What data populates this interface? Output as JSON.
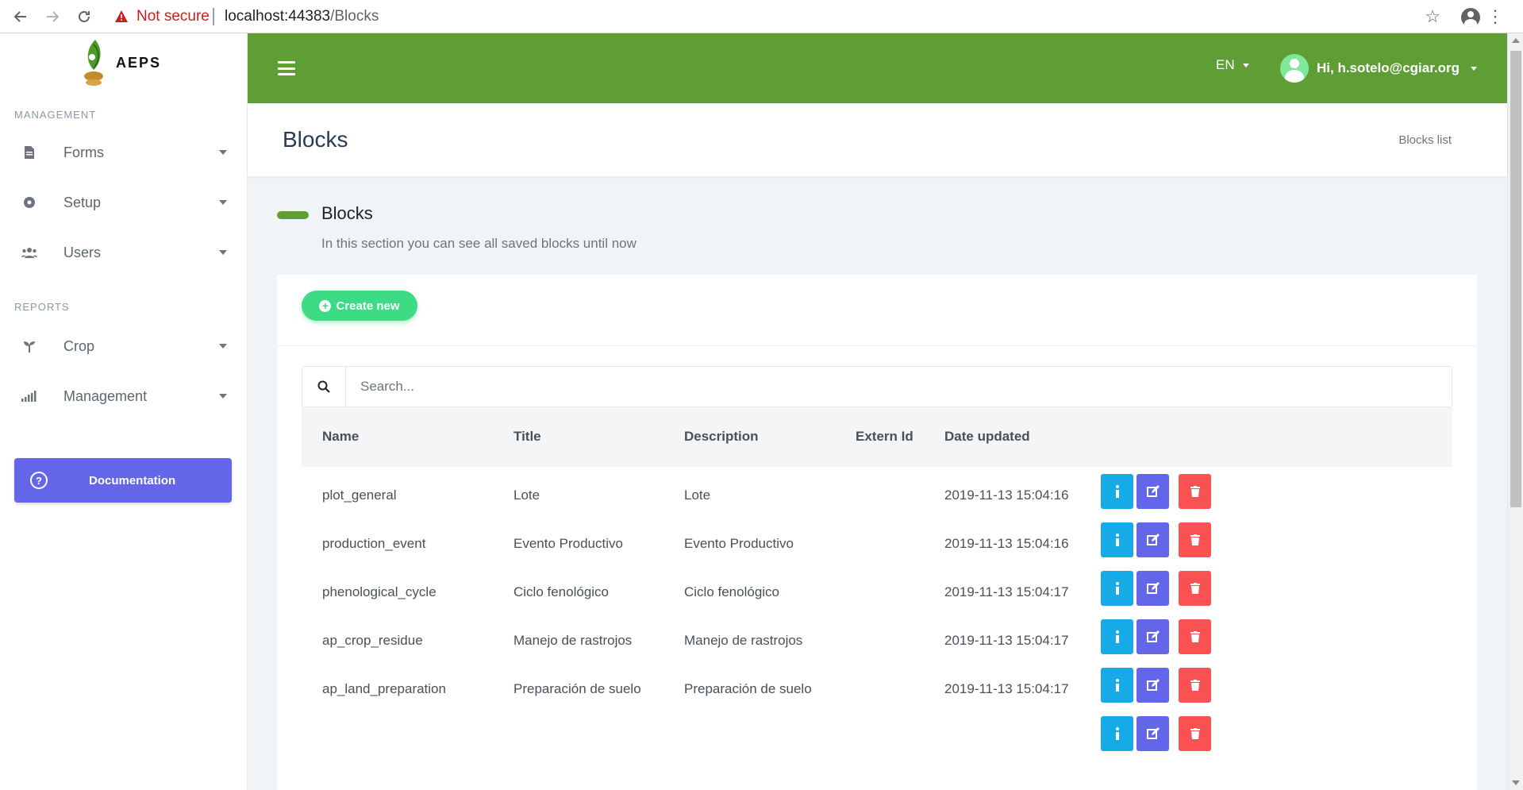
{
  "browser": {
    "security_label": "Not secure",
    "url_host": "localhost:44383",
    "url_path": "/Blocks"
  },
  "sidebar": {
    "app_name": "AEPS",
    "management_title": "MANAGEMENT",
    "reports_title": "REPORTS",
    "items": [
      {
        "label": "Forms",
        "icon": "file-icon"
      },
      {
        "label": "Setup",
        "icon": "gear-icon"
      },
      {
        "label": "Users",
        "icon": "users-icon"
      },
      {
        "label": "Crop",
        "icon": "sprout-icon"
      },
      {
        "label": "Management",
        "icon": "bar-chart-icon"
      }
    ],
    "documentation_label": "Documentation"
  },
  "header": {
    "language": "EN",
    "greeting": "Hi, h.sotelo@cgiar.org"
  },
  "page": {
    "title": "Blocks",
    "breadcrumb": "Blocks list",
    "section_title": "Blocks",
    "section_subtitle": "In this section you can see all saved blocks until now"
  },
  "toolbar": {
    "create_label": "Create new",
    "search_placeholder": "Search..."
  },
  "table": {
    "columns": [
      "Name",
      "Title",
      "Description",
      "Extern Id",
      "Date updated"
    ],
    "rows": [
      {
        "name": "plot_general",
        "title": "Lote",
        "description": "Lote",
        "extern_id": "",
        "date": "2019-11-13 15:04:16"
      },
      {
        "name": "production_event",
        "title": "Evento Productivo",
        "description": "Evento Productivo",
        "extern_id": "",
        "date": "2019-11-13 15:04:16"
      },
      {
        "name": "phenological_cycle",
        "title": "Ciclo fenológico",
        "description": "Ciclo fenológico",
        "extern_id": "",
        "date": "2019-11-13 15:04:17"
      },
      {
        "name": "ap_crop_residue",
        "title": "Manejo de rastrojos",
        "description": "Manejo de rastrojos",
        "extern_id": "",
        "date": "2019-11-13 15:04:17"
      },
      {
        "name": "ap_land_preparation",
        "title": "Preparación de suelo",
        "description": "Preparación de suelo",
        "extern_id": "",
        "date": "2019-11-13 15:04:17"
      }
    ]
  },
  "colors": {
    "brand_green": "#5e9e35",
    "create_green": "#3ddc84",
    "info_blue": "#16aae7",
    "edit_purple": "#6366e8",
    "delete_red": "#fa5252"
  }
}
